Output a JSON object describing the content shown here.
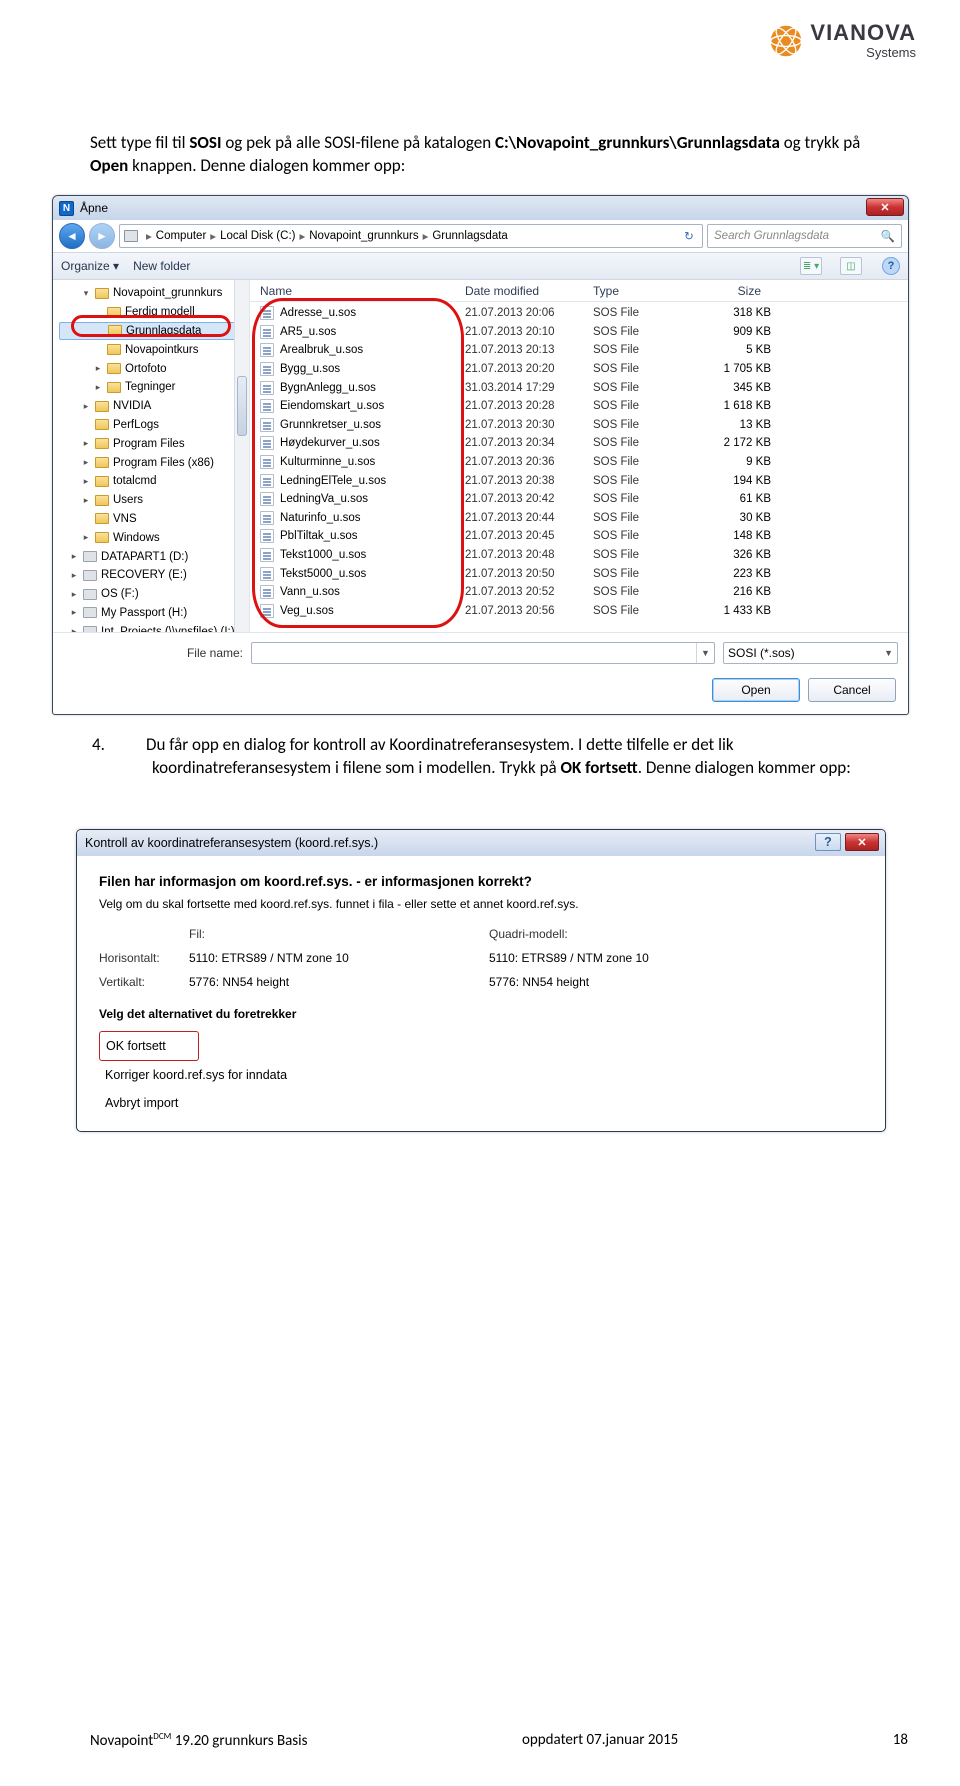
{
  "logo": {
    "brand": "VIANOVA",
    "sub": "Systems"
  },
  "para1_pre": "Sett type fil til ",
  "para1_b1": "SOSI",
  "para1_mid": " og pek på alle SOSI-filene på katalogen ",
  "para1_b2": "C:\\Novapoint_grunnkurs\\Grunnlagsdata",
  "para1_mid2": " og trykk på ",
  "para1_b3": "Open",
  "para1_end": " knappen. Denne dialogen kommer opp:",
  "para2_num": "4.",
  "para2_a": "Du får opp en dialog for kontroll av Koordinatreferansesystem. I dette tilfelle er det lik koordinatreferansesystem i filene som i modellen. Trykk på ",
  "para2_b": "OK fortsett",
  "para2_c": ". Denne dialogen kommer opp:",
  "open": {
    "title": "Åpne",
    "breadcrumb": [
      "Computer",
      "Local Disk (C:)",
      "Novapoint_grunnkurs",
      "Grunnlagsdata"
    ],
    "search_placeholder": "Search Grunnlagsdata",
    "toolbar": {
      "organize": "Organize ▾",
      "newfolder": "New folder"
    },
    "cols": {
      "name": "Name",
      "date": "Date modified",
      "type": "Type",
      "size": "Size"
    },
    "tree": [
      {
        "t": "▾",
        "k": "folder",
        "l": "Novapoint_grunnkurs",
        "d": 0,
        "sel": false
      },
      {
        "t": "",
        "k": "folder",
        "l": "Ferdig modell",
        "d": 1,
        "sel": false
      },
      {
        "t": "",
        "k": "folder",
        "l": "Grunnlagsdata",
        "d": 1,
        "sel": true
      },
      {
        "t": "",
        "k": "folder",
        "l": "Novapointkurs",
        "d": 1,
        "sel": false
      },
      {
        "t": "▸",
        "k": "folder",
        "l": "Ortofoto",
        "d": 1,
        "sel": false
      },
      {
        "t": "▸",
        "k": "folder",
        "l": "Tegninger",
        "d": 1,
        "sel": false
      },
      {
        "t": "▸",
        "k": "folder",
        "l": "NVIDIA",
        "d": 0,
        "sel": false
      },
      {
        "t": "",
        "k": "folder",
        "l": "PerfLogs",
        "d": 0,
        "sel": false
      },
      {
        "t": "▸",
        "k": "folder",
        "l": "Program Files",
        "d": 0,
        "sel": false
      },
      {
        "t": "▸",
        "k": "folder",
        "l": "Program Files (x86)",
        "d": 0,
        "sel": false
      },
      {
        "t": "▸",
        "k": "folder",
        "l": "totalcmd",
        "d": 0,
        "sel": false
      },
      {
        "t": "▸",
        "k": "folder",
        "l": "Users",
        "d": 0,
        "sel": false
      },
      {
        "t": "",
        "k": "folder",
        "l": "VNS",
        "d": 0,
        "sel": false
      },
      {
        "t": "▸",
        "k": "folder",
        "l": "Windows",
        "d": 0,
        "sel": false
      },
      {
        "t": "▸",
        "k": "drive",
        "l": "DATAPART1 (D:)",
        "d": -1,
        "sel": false
      },
      {
        "t": "▸",
        "k": "drive",
        "l": "RECOVERY (E:)",
        "d": -1,
        "sel": false
      },
      {
        "t": "▸",
        "k": "drive",
        "l": "OS (F:)",
        "d": -1,
        "sel": false
      },
      {
        "t": "▸",
        "k": "drive",
        "l": "My Passport (H:)",
        "d": -1,
        "sel": false
      },
      {
        "t": "▸",
        "k": "drive",
        "l": "Int_Projects (\\\\vnsfiles) (I:)",
        "d": -1,
        "sel": false
      }
    ],
    "files": [
      {
        "n": "Adresse_u.sos",
        "d": "21.07.2013 20:06",
        "t": "SOS File",
        "s": "318 KB"
      },
      {
        "n": "AR5_u.sos",
        "d": "21.07.2013 20:10",
        "t": "SOS File",
        "s": "909 KB"
      },
      {
        "n": "Arealbruk_u.sos",
        "d": "21.07.2013 20:13",
        "t": "SOS File",
        "s": "5 KB"
      },
      {
        "n": "Bygg_u.sos",
        "d": "21.07.2013 20:20",
        "t": "SOS File",
        "s": "1 705 KB"
      },
      {
        "n": "BygnAnlegg_u.sos",
        "d": "31.03.2014 17:29",
        "t": "SOS File",
        "s": "345 KB"
      },
      {
        "n": "Eiendomskart_u.sos",
        "d": "21.07.2013 20:28",
        "t": "SOS File",
        "s": "1 618 KB"
      },
      {
        "n": "Grunnkretser_u.sos",
        "d": "21.07.2013 20:30",
        "t": "SOS File",
        "s": "13 KB"
      },
      {
        "n": "Høydekurver_u.sos",
        "d": "21.07.2013 20:34",
        "t": "SOS File",
        "s": "2 172 KB"
      },
      {
        "n": "Kulturminne_u.sos",
        "d": "21.07.2013 20:36",
        "t": "SOS File",
        "s": "9 KB"
      },
      {
        "n": "LedningElTele_u.sos",
        "d": "21.07.2013 20:38",
        "t": "SOS File",
        "s": "194 KB"
      },
      {
        "n": "LedningVa_u.sos",
        "d": "21.07.2013 20:42",
        "t": "SOS File",
        "s": "61 KB"
      },
      {
        "n": "Naturinfo_u.sos",
        "d": "21.07.2013 20:44",
        "t": "SOS File",
        "s": "30 KB"
      },
      {
        "n": "PblTiltak_u.sos",
        "d": "21.07.2013 20:45",
        "t": "SOS File",
        "s": "148 KB"
      },
      {
        "n": "Tekst1000_u.sos",
        "d": "21.07.2013 20:48",
        "t": "SOS File",
        "s": "326 KB"
      },
      {
        "n": "Tekst5000_u.sos",
        "d": "21.07.2013 20:50",
        "t": "SOS File",
        "s": "223 KB"
      },
      {
        "n": "Vann_u.sos",
        "d": "21.07.2013 20:52",
        "t": "SOS File",
        "s": "216 KB"
      },
      {
        "n": "Veg_u.sos",
        "d": "21.07.2013 20:56",
        "t": "SOS File",
        "s": "1 433 KB"
      }
    ],
    "file_label": "File name:",
    "type_filter": "SOSI (*.sos)",
    "open_btn": "Open",
    "cancel_btn": "Cancel"
  },
  "koord": {
    "title": "Kontroll av koordinatreferansesystem (koord.ref.sys.)",
    "heading": "Filen har informasjon om koord.ref.sys. - er informasjonen korrekt?",
    "sub": "Velg om du skal fortsette med koord.ref.sys. funnet i fila - eller sette et annet koord.ref.sys.",
    "col_file": "Fil:",
    "col_model": "Quadri-modell:",
    "row_h": "Horisontalt:",
    "row_v": "Vertikalt:",
    "h_file": "5110: ETRS89 / NTM zone 10",
    "h_model": "5110: ETRS89 / NTM zone 10",
    "v_file": "5776: NN54 height",
    "v_model": "5776: NN54 height",
    "choose": "Velg det alternativet du foretrekker",
    "opt1": "OK fortsett",
    "opt2": "Korriger koord.ref.sys for inndata",
    "opt3": "Avbryt import"
  },
  "footer": {
    "left_a": "Novapoint",
    "left_sup": "DCM",
    "left_b": " 19.20 grunnkurs Basis",
    "mid": "oppdatert 07.januar 2015",
    "right": "18"
  }
}
